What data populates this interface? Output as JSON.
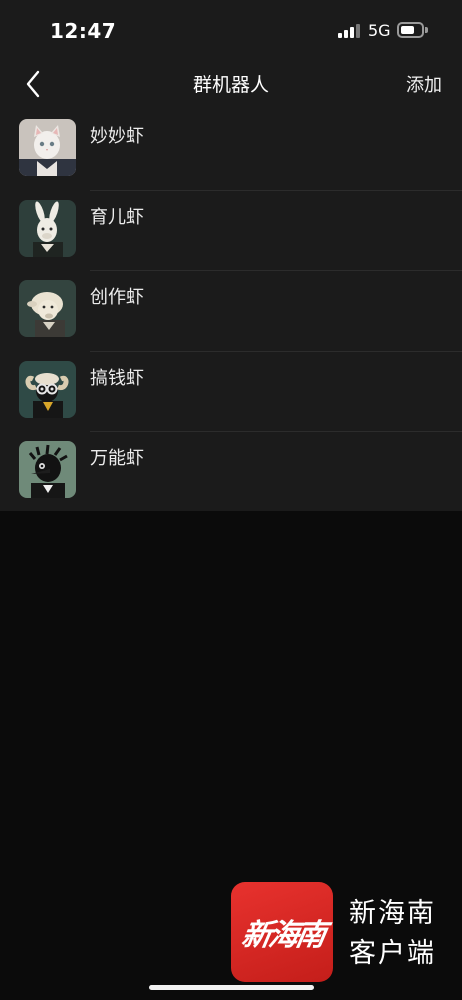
{
  "status_bar": {
    "time": "12:47",
    "network": "5G",
    "battery_level_fraction": 0.6
  },
  "nav": {
    "title": "群机器人",
    "add_label": "添加",
    "back_icon": "chevron-left-icon"
  },
  "bots": [
    {
      "name": "妙妙虾",
      "avatar": "cat-avatar"
    },
    {
      "name": "育儿虾",
      "avatar": "rabbit-avatar"
    },
    {
      "name": "创作虾",
      "avatar": "sheep-avatar"
    },
    {
      "name": "搞钱虾",
      "avatar": "ram-avatar"
    },
    {
      "name": "万能虾",
      "avatar": "bird-avatar"
    }
  ],
  "watermark": {
    "logo_text": "新海南",
    "line1": "新海南",
    "line2": "客户端"
  },
  "colors": {
    "background": "#0b0b0b",
    "panel": "#1b1b1b",
    "divider": "#2c2c2c",
    "brand_red": "#d9261f"
  }
}
